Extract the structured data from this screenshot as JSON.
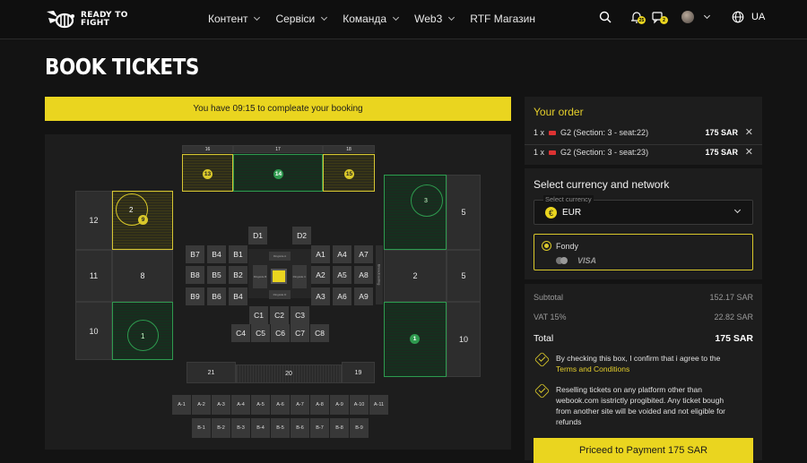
{
  "header": {
    "logo_line1": "READY TO",
    "logo_line2": "FIGHT",
    "nav": [
      "Контент",
      "Сервіси",
      "Команда",
      "Web3",
      "RTF Магазин"
    ],
    "notif_count_1": "25",
    "notif_count_2": "2",
    "language": "UA"
  },
  "page": {
    "title": "BOOK TICKETS",
    "timer_text": "You have 09:15 to compleate your booking"
  },
  "map": {
    "top_labels": [
      "16",
      "17",
      "18"
    ],
    "top_sections": [
      "13",
      "14",
      "15"
    ],
    "left_sections": [
      "12",
      "2",
      "9",
      "11",
      "8",
      "10",
      "1"
    ],
    "right_sections": [
      "3",
      "5",
      "2",
      "5",
      "1",
      "10"
    ],
    "bottom_sections": [
      "21",
      "20",
      "19"
    ],
    "d_row": [
      "D1",
      "D2"
    ],
    "left_block": [
      [
        "B7",
        "B4",
        "B1"
      ],
      [
        "B8",
        "B5",
        "B2"
      ],
      [
        "B9",
        "B6",
        "B4"
      ]
    ],
    "right_block": [
      [
        "A1",
        "A4",
        "A7"
      ],
      [
        "A2",
        "A5",
        "A8"
      ],
      [
        "A3",
        "A6",
        "A9"
      ]
    ],
    "c_row1": [
      "C1",
      "C2",
      "C3"
    ],
    "c_row2": [
      "C4",
      "C5",
      "C6",
      "C7",
      "C8"
    ],
    "ring_labels": [
      "Ringside A",
      "Ringside B",
      "Ringside C",
      "Ringside D"
    ],
    "a_row": [
      "A-1",
      "A-2",
      "A-3",
      "A-4",
      "A-5",
      "A-6",
      "A-7",
      "A-8",
      "A-9",
      "A-10",
      "A-11"
    ],
    "b_row": [
      "B-1",
      "B-2",
      "B-3",
      "B-4",
      "B-5",
      "B-6",
      "B-7",
      "B-8",
      "B-9"
    ],
    "broadcasting": "Broadcasting"
  },
  "order": {
    "title": "Your order",
    "items": [
      {
        "qty": "1 x",
        "name": "G2 (Section: 3 - seat:22)",
        "price": "175 SAR"
      },
      {
        "qty": "1 x",
        "name": "G2 (Section: 3 - seat:23)",
        "price": "175 SAR"
      }
    ]
  },
  "currency": {
    "title": "Select currency and network",
    "select_label": "Select currency",
    "selected": "EUR",
    "method": "Fondy",
    "card_brand": "VISA"
  },
  "summary": {
    "subtotal_label": "Subtotal",
    "subtotal": "152.17 SAR",
    "vat_label": "VAT 15%",
    "vat": "22.82 SAR",
    "total_label": "Total",
    "total": "175 SAR",
    "terms_text": "By checking this box, I confirm that i agree to the",
    "terms_link": "Terms and Conditions",
    "resell_line1": "Reselling tickets on any platform other than",
    "resell_line2": "webook.com isstrictly progibited. Any ticket bough",
    "resell_line3": "from another site will be voided and not eligible for",
    "resell_line4": "refunds",
    "pay_button": "Priceed to Payment 175 SAR"
  },
  "colors": {
    "accent": "#ead51f",
    "green_zone": "#2f9a4f"
  }
}
